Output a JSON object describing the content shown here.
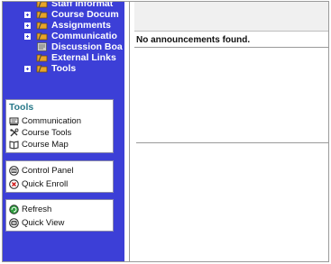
{
  "tree": {
    "items": [
      {
        "label": "Staff Informat",
        "expandable": false
      },
      {
        "label": "Course Docum",
        "expandable": true
      },
      {
        "label": "Assignments",
        "expandable": true
      },
      {
        "label": "Communicatio",
        "expandable": true
      },
      {
        "label": "Discussion Boa",
        "expandable": false
      },
      {
        "label": "External Links",
        "expandable": false
      },
      {
        "label": "Tools",
        "expandable": true
      }
    ]
  },
  "tools_panel": {
    "title": "Tools",
    "items": [
      {
        "label": "Communication",
        "icon": "communication-icon"
      },
      {
        "label": "Course Tools",
        "icon": "course-tools-icon"
      },
      {
        "label": "Course Map",
        "icon": "course-map-icon"
      }
    ]
  },
  "control_panel": {
    "items": [
      {
        "label": "Control Panel",
        "icon": "control-panel-icon"
      },
      {
        "label": "Quick Enroll",
        "icon": "quick-enroll-icon"
      }
    ]
  },
  "view_panel": {
    "items": [
      {
        "label": "Refresh",
        "icon": "refresh-icon"
      },
      {
        "label": "Quick View",
        "icon": "quick-view-icon"
      }
    ]
  },
  "main": {
    "message": "No announcements found."
  },
  "colors": {
    "sidebar_bg": "#3c3fd7",
    "folder": "#e8a52a",
    "panel_title": "#2a7a8a"
  }
}
